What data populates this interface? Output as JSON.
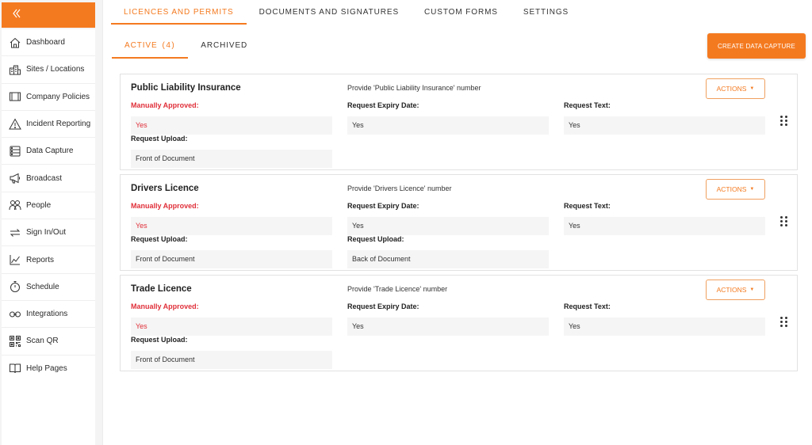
{
  "sidebar": {
    "collapse_icon": "double-chevron-left-icon",
    "items": [
      {
        "label": "Dashboard",
        "icon": "house-icon"
      },
      {
        "label": "Sites / Locations",
        "icon": "buildings-icon"
      },
      {
        "label": "Company Policies",
        "icon": "book-icon"
      },
      {
        "label": "Incident Reporting",
        "icon": "warning-icon"
      },
      {
        "label": "Data Capture",
        "icon": "database-icon"
      },
      {
        "label": "Broadcast",
        "icon": "megaphone-icon"
      },
      {
        "label": "People",
        "icon": "people-icon"
      },
      {
        "label": "Sign In/Out",
        "icon": "swap-arrows-icon"
      },
      {
        "label": "Reports",
        "icon": "chart-line-icon"
      },
      {
        "label": "Schedule",
        "icon": "stopwatch-icon"
      },
      {
        "label": "Integrations",
        "icon": "link-icon"
      },
      {
        "label": "Scan QR",
        "icon": "qr-code-icon"
      },
      {
        "label": "Help Pages",
        "icon": "open-book-icon"
      }
    ]
  },
  "top_tabs": [
    "LICENCES AND PERMITS",
    "DOCUMENTS AND SIGNATURES",
    "CUSTOM FORMS",
    "SETTINGS"
  ],
  "sub_tabs": {
    "active_label": "ACTIVE",
    "active_count": "(4)",
    "archived_label": "ARCHIVED"
  },
  "create_button": "CREATE DATA CAPTURE",
  "actions_label": "ACTIONS",
  "accent_color": "#f47a20",
  "cards": [
    {
      "title": "Public Liability Insurance",
      "prompt": "Provide 'Public Liability Insurance' number",
      "fields": [
        {
          "label": "Manually Approved:",
          "value": "Yes"
        },
        {
          "label": "Request Expiry Date:",
          "value": "Yes"
        },
        {
          "label": "Request Text:",
          "value": "Yes"
        },
        {
          "label": "Request Upload:",
          "value": "Front of Document"
        }
      ]
    },
    {
      "title": "Drivers Licence",
      "prompt": "Provide 'Drivers Licence' number",
      "fields": [
        {
          "label": "Manually Approved:",
          "value": "Yes"
        },
        {
          "label": "Request Expiry Date:",
          "value": "Yes"
        },
        {
          "label": "Request Text:",
          "value": "Yes"
        },
        {
          "label": "Request Upload:",
          "value": "Front of Document"
        },
        {
          "label": "Request Upload:",
          "value": "Back of Document"
        }
      ]
    },
    {
      "title": "Trade Licence",
      "prompt": "Provide 'Trade Licence' number",
      "fields": [
        {
          "label": "Manually Approved:",
          "value": "Yes"
        },
        {
          "label": "Request Expiry Date:",
          "value": "Yes"
        },
        {
          "label": "Request Text:",
          "value": "Yes"
        },
        {
          "label": "Request Upload:",
          "value": "Front of Document"
        }
      ]
    }
  ]
}
